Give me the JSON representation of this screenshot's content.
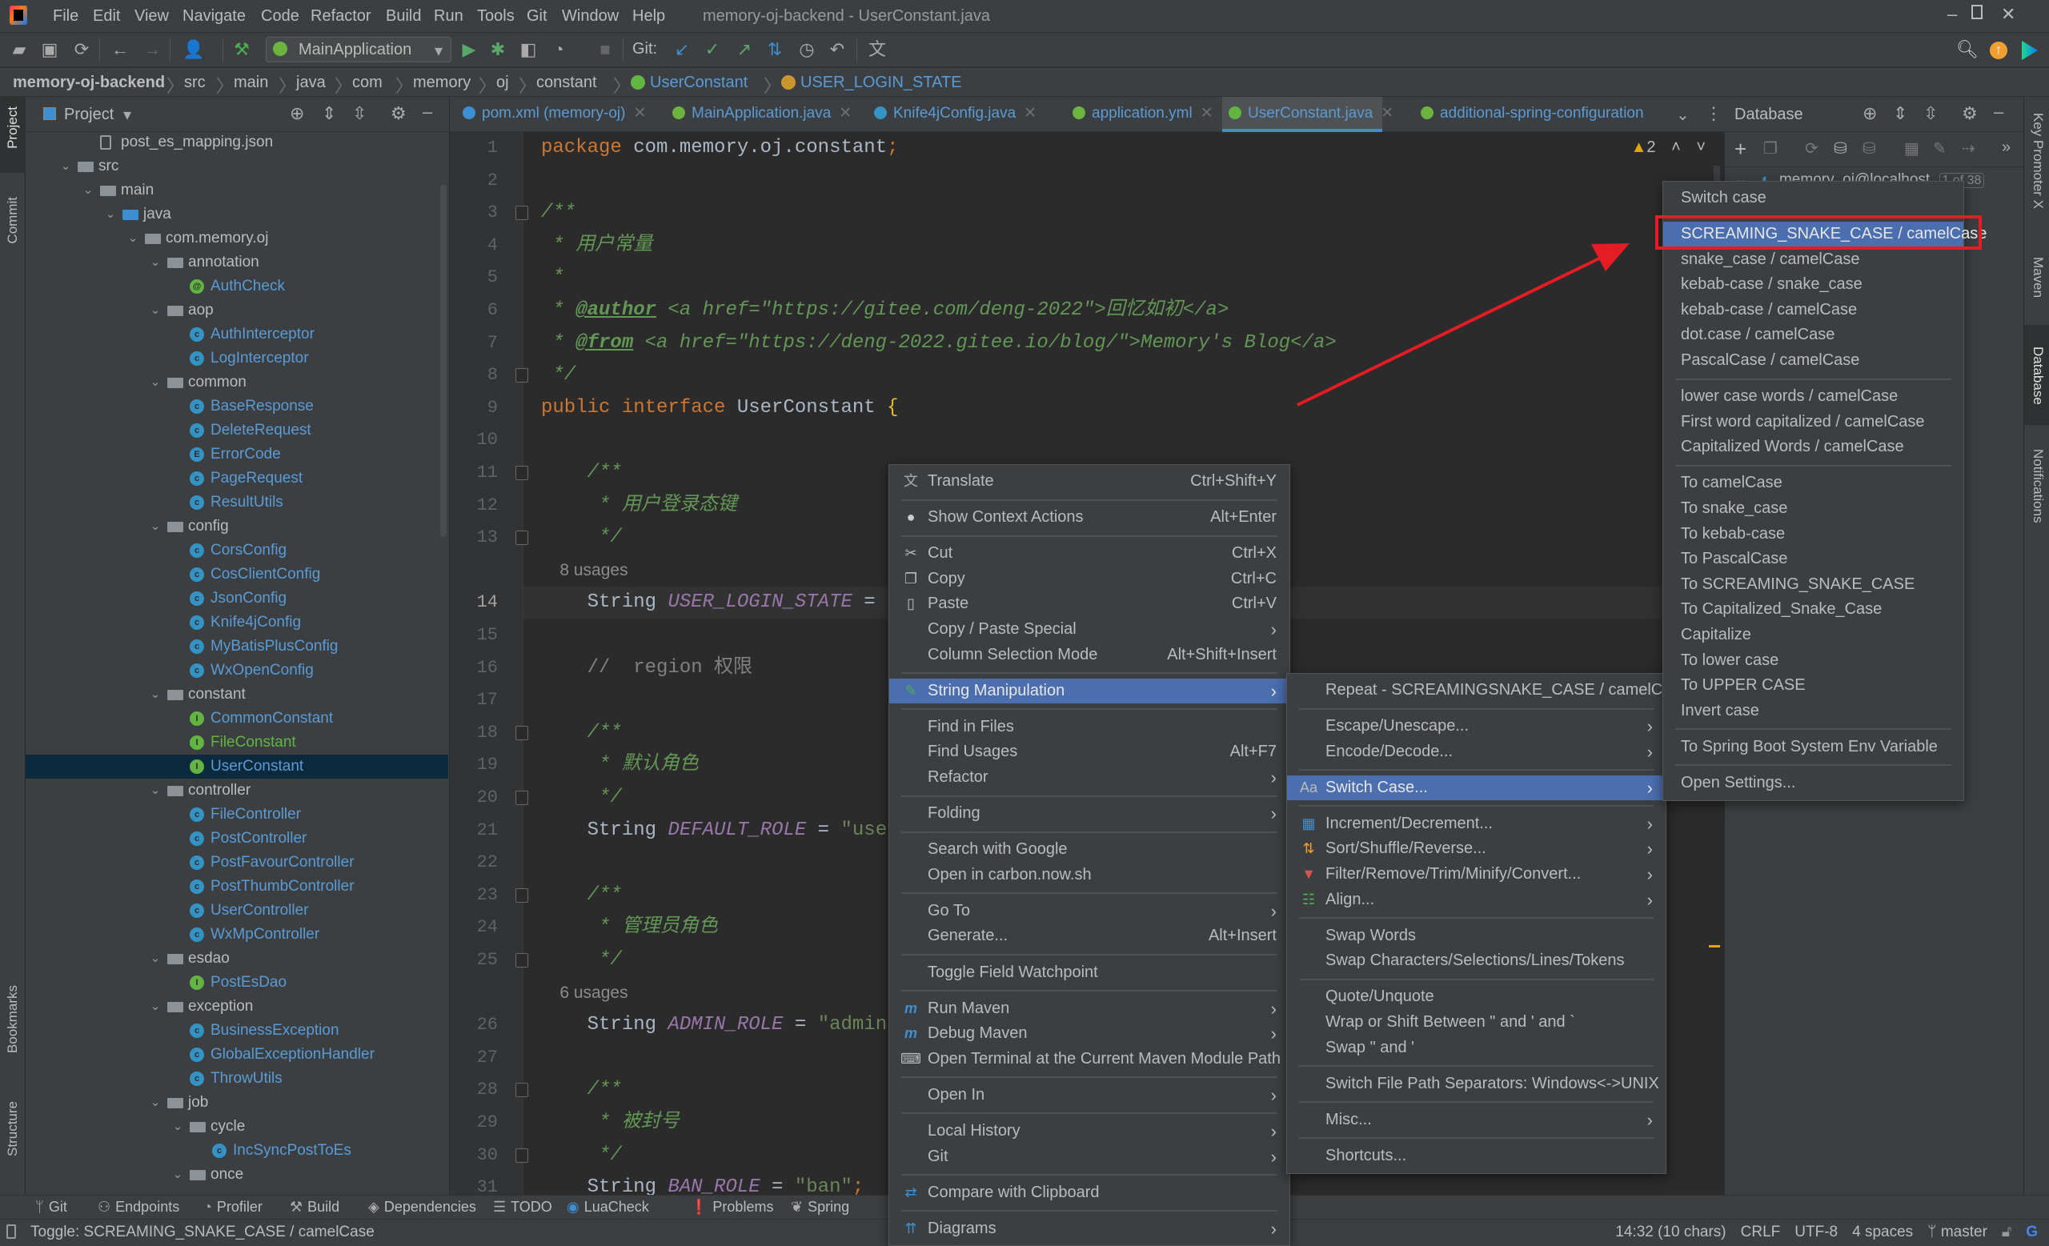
{
  "window": {
    "title": "memory-oj-backend - UserConstant.java",
    "menu": [
      "File",
      "Edit",
      "View",
      "Navigate",
      "Code",
      "Refactor",
      "Build",
      "Run",
      "Tools",
      "Git",
      "Window",
      "Help"
    ]
  },
  "toolbar": {
    "run_config": "MainApplication",
    "git_label": "Git:"
  },
  "breadcrumb": [
    "memory-oj-backend",
    "src",
    "main",
    "java",
    "com",
    "memory",
    "oj",
    "constant",
    "UserConstant",
    "USER_LOGIN_STATE"
  ],
  "left_stripe": {
    "project": "Project",
    "commit": "Commit",
    "bookmarks": "Bookmarks",
    "structure": "Structure"
  },
  "right_stripe": {
    "key_promoter": "Key Promoter X",
    "maven": "Maven",
    "database": "Database",
    "notifications": "Notifications"
  },
  "project": {
    "title": "Project",
    "tree": [
      {
        "label": "post_es_mapping.json",
        "level": 3,
        "type": "file"
      },
      {
        "label": "src",
        "level": 2,
        "type": "folder",
        "expanded": true
      },
      {
        "label": "main",
        "level": 3,
        "type": "folder",
        "expanded": true
      },
      {
        "label": "java",
        "level": 4,
        "type": "source-folder",
        "expanded": true
      },
      {
        "label": "com.memory.oj",
        "level": 5,
        "type": "package",
        "expanded": true
      },
      {
        "label": "annotation",
        "level": 6,
        "type": "package",
        "expanded": true
      },
      {
        "label": "AuthCheck",
        "level": 7,
        "type": "annotation"
      },
      {
        "label": "aop",
        "level": 6,
        "type": "package",
        "expanded": true
      },
      {
        "label": "AuthInterceptor",
        "level": 7,
        "type": "class"
      },
      {
        "label": "LogInterceptor",
        "level": 7,
        "type": "class"
      },
      {
        "label": "common",
        "level": 6,
        "type": "package",
        "expanded": true
      },
      {
        "label": "BaseResponse",
        "level": 7,
        "type": "class"
      },
      {
        "label": "DeleteRequest",
        "level": 7,
        "type": "class"
      },
      {
        "label": "ErrorCode",
        "level": 7,
        "type": "enum"
      },
      {
        "label": "PageRequest",
        "level": 7,
        "type": "class"
      },
      {
        "label": "ResultUtils",
        "level": 7,
        "type": "class"
      },
      {
        "label": "config",
        "level": 6,
        "type": "package",
        "expanded": true
      },
      {
        "label": "CorsConfig",
        "level": 7,
        "type": "class"
      },
      {
        "label": "CosClientConfig",
        "level": 7,
        "type": "class"
      },
      {
        "label": "JsonConfig",
        "level": 7,
        "type": "class"
      },
      {
        "label": "Knife4jConfig",
        "level": 7,
        "type": "class"
      },
      {
        "label": "MyBatisPlusConfig",
        "level": 7,
        "type": "class"
      },
      {
        "label": "WxOpenConfig",
        "level": 7,
        "type": "class"
      },
      {
        "label": "constant",
        "level": 6,
        "type": "package",
        "expanded": true
      },
      {
        "label": "CommonConstant",
        "level": 7,
        "type": "interface"
      },
      {
        "label": "FileConstant",
        "level": 7,
        "type": "interface",
        "status": "added"
      },
      {
        "label": "UserConstant",
        "level": 7,
        "type": "interface",
        "selected": true
      },
      {
        "label": "controller",
        "level": 6,
        "type": "package",
        "expanded": true
      },
      {
        "label": "FileController",
        "level": 7,
        "type": "class"
      },
      {
        "label": "PostController",
        "level": 7,
        "type": "class"
      },
      {
        "label": "PostFavourController",
        "level": 7,
        "type": "class"
      },
      {
        "label": "PostThumbController",
        "level": 7,
        "type": "class"
      },
      {
        "label": "UserController",
        "level": 7,
        "type": "class"
      },
      {
        "label": "WxMpController",
        "level": 7,
        "type": "class"
      },
      {
        "label": "esdao",
        "level": 6,
        "type": "package",
        "expanded": true
      },
      {
        "label": "PostEsDao",
        "level": 7,
        "type": "interface"
      },
      {
        "label": "exception",
        "level": 6,
        "type": "package",
        "expanded": true
      },
      {
        "label": "BusinessException",
        "level": 7,
        "type": "class"
      },
      {
        "label": "GlobalExceptionHandler",
        "level": 7,
        "type": "class"
      },
      {
        "label": "ThrowUtils",
        "level": 7,
        "type": "class"
      },
      {
        "label": "job",
        "level": 6,
        "type": "package",
        "expanded": true
      },
      {
        "label": "cycle",
        "level": 7,
        "type": "package",
        "expanded": true
      },
      {
        "label": "IncSyncPostToEs",
        "level": 8,
        "type": "class"
      },
      {
        "label": "once",
        "level": 7,
        "type": "package",
        "expanded": true
      }
    ]
  },
  "editor": {
    "tabs": [
      {
        "label": "pom.xml (memory-oj)",
        "icon": "maven-icon"
      },
      {
        "label": "MainApplication.java",
        "icon": "spring-boot-icon"
      },
      {
        "label": "Knife4jConfig.java",
        "icon": "class-icon"
      },
      {
        "label": "application.yml",
        "icon": "spring-config-icon"
      },
      {
        "label": "UserConstant.java",
        "icon": "interface-icon",
        "active": true
      },
      {
        "label": "additional-spring-configuration",
        "icon": "spring-config-icon"
      }
    ],
    "warnings": "2",
    "current_line": 14,
    "lines": [
      {
        "n": 1,
        "seg": [
          {
            "t": "package",
            "k": "keyword"
          },
          {
            "t": " com.memory.oj.constant",
            "k": "plain"
          },
          {
            "t": ";",
            "k": "keyword"
          }
        ]
      },
      {
        "n": 2,
        "seg": []
      },
      {
        "n": 3,
        "seg": [
          {
            "t": "/**",
            "k": "doc"
          }
        ],
        "fold": true
      },
      {
        "n": 4,
        "seg": [
          {
            "t": " * 用户常量",
            "k": "doc"
          }
        ]
      },
      {
        "n": 5,
        "seg": [
          {
            "t": " *",
            "k": "doc"
          }
        ]
      },
      {
        "n": 6,
        "seg": [
          {
            "t": " * ",
            "k": "doc"
          },
          {
            "t": "@author",
            "k": "doctag"
          },
          {
            "t": " <a href=\"https://gitee.com/deng-2022\">回忆如初</a>",
            "k": "doc"
          }
        ]
      },
      {
        "n": 7,
        "seg": [
          {
            "t": " * ",
            "k": "doc"
          },
          {
            "t": "@from",
            "k": "doctag"
          },
          {
            "t": " <a href=\"https://deng-2022.gitee.io/blog/\">Memory's Blog</a>",
            "k": "doc"
          }
        ]
      },
      {
        "n": 8,
        "seg": [
          {
            "t": " */",
            "k": "doc"
          }
        ],
        "fold": true
      },
      {
        "n": 9,
        "seg": [
          {
            "t": "public interface ",
            "k": "keyword"
          },
          {
            "t": "UserConstant ",
            "k": "plain"
          },
          {
            "t": "{",
            "k": "brace"
          }
        ]
      },
      {
        "n": 10,
        "seg": []
      },
      {
        "n": 11,
        "seg": [
          {
            "t": "    /**",
            "k": "doc"
          }
        ],
        "fold": true
      },
      {
        "n": 12,
        "seg": [
          {
            "t": "     * 用户登录态键",
            "k": "doc"
          }
        ]
      },
      {
        "n": 13,
        "seg": [
          {
            "t": "     */",
            "k": "doc"
          }
        ],
        "fold": true
      },
      {
        "n": null,
        "seg": [
          {
            "t": "    8 usages",
            "k": "usages"
          }
        ]
      },
      {
        "n": 14,
        "seg": [
          {
            "t": "    String ",
            "k": "plain"
          },
          {
            "t": "USER_LOGIN_STATE",
            "k": "const"
          },
          {
            "t": " = \"",
            "k": "plain"
          }
        ]
      },
      {
        "n": 15,
        "seg": []
      },
      {
        "n": 16,
        "seg": [
          {
            "t": "    //  region 权限",
            "k": "comment"
          }
        ]
      },
      {
        "n": 17,
        "seg": []
      },
      {
        "n": 18,
        "seg": [
          {
            "t": "    /**",
            "k": "doc"
          }
        ],
        "fold": true
      },
      {
        "n": 19,
        "seg": [
          {
            "t": "     * 默认角色",
            "k": "doc"
          }
        ]
      },
      {
        "n": 20,
        "seg": [
          {
            "t": "     */",
            "k": "doc"
          }
        ],
        "fold": true
      },
      {
        "n": 21,
        "seg": [
          {
            "t": "    String ",
            "k": "plain"
          },
          {
            "t": "DEFAULT_ROLE",
            "k": "const"
          },
          {
            "t": " = ",
            "k": "plain"
          },
          {
            "t": "\"user",
            "k": "string"
          }
        ]
      },
      {
        "n": 22,
        "seg": []
      },
      {
        "n": 23,
        "seg": [
          {
            "t": "    /**",
            "k": "doc"
          }
        ],
        "fold": true
      },
      {
        "n": 24,
        "seg": [
          {
            "t": "     * 管理员角色",
            "k": "doc"
          }
        ]
      },
      {
        "n": 25,
        "seg": [
          {
            "t": "     */",
            "k": "doc"
          }
        ],
        "fold": true
      },
      {
        "n": null,
        "seg": [
          {
            "t": "    6 usages",
            "k": "usages"
          }
        ]
      },
      {
        "n": 26,
        "seg": [
          {
            "t": "    String ",
            "k": "plain"
          },
          {
            "t": "ADMIN_ROLE",
            "k": "const"
          },
          {
            "t": " = ",
            "k": "plain"
          },
          {
            "t": "\"admin\"",
            "k": "string"
          }
        ]
      },
      {
        "n": 27,
        "seg": []
      },
      {
        "n": 28,
        "seg": [
          {
            "t": "    /**",
            "k": "doc"
          }
        ],
        "fold": true
      },
      {
        "n": 29,
        "seg": [
          {
            "t": "     * 被封号",
            "k": "doc"
          }
        ]
      },
      {
        "n": 30,
        "seg": [
          {
            "t": "     */",
            "k": "doc"
          }
        ],
        "fold": true
      },
      {
        "n": 31,
        "seg": [
          {
            "t": "    String ",
            "k": "plain"
          },
          {
            "t": "BAN_ROLE",
            "k": "const"
          },
          {
            "t": " = ",
            "k": "plain"
          },
          {
            "t": "\"ban\"",
            "k": "string"
          },
          {
            "t": ";",
            "k": "keyword"
          }
        ]
      }
    ]
  },
  "database": {
    "title": "Database",
    "datasource": "memory_oj@localhost",
    "count": "1 of 38"
  },
  "context_menu": [
    {
      "label": "Translate",
      "shortcut": "Ctrl+Shift+Y",
      "icon": "translate-icon"
    },
    {
      "sep": true
    },
    {
      "label": "Show Context Actions",
      "shortcut": "Alt+Enter",
      "icon": "lightbulb-icon"
    },
    {
      "sep": true
    },
    {
      "label": "Cut",
      "shortcut": "Ctrl+X",
      "icon": "scissors-icon"
    },
    {
      "label": "Copy",
      "shortcut": "Ctrl+C",
      "icon": "copy-icon"
    },
    {
      "label": "Paste",
      "shortcut": "Ctrl+V",
      "icon": "paste-icon"
    },
    {
      "label": "Copy / Paste Special",
      "submenu": true
    },
    {
      "label": "Column Selection Mode",
      "shortcut": "Alt+Shift+Insert"
    },
    {
      "sep": true
    },
    {
      "label": "String Manipulation",
      "submenu": true,
      "icon": "pencil-icon",
      "highlighted": true
    },
    {
      "sep": true
    },
    {
      "label": "Find in Files"
    },
    {
      "label": "Find Usages",
      "shortcut": "Alt+F7"
    },
    {
      "label": "Refactor",
      "submenu": true
    },
    {
      "sep": true
    },
    {
      "label": "Folding",
      "submenu": true
    },
    {
      "sep": true
    },
    {
      "label": "Search with Google"
    },
    {
      "label": "Open in carbon.now.sh"
    },
    {
      "sep": true
    },
    {
      "label": "Go To",
      "submenu": true
    },
    {
      "label": "Generate...",
      "shortcut": "Alt+Insert"
    },
    {
      "sep": true
    },
    {
      "label": "Toggle Field Watchpoint"
    },
    {
      "sep": true
    },
    {
      "label": "Run Maven",
      "submenu": true,
      "icon": "maven-run-icon"
    },
    {
      "label": "Debug Maven",
      "submenu": true,
      "icon": "maven-debug-icon"
    },
    {
      "label": "Open Terminal at the Current Maven Module Path",
      "icon": "terminal-maven-icon"
    },
    {
      "sep": true
    },
    {
      "label": "Open In",
      "submenu": true
    },
    {
      "sep": true
    },
    {
      "label": "Local History",
      "submenu": true
    },
    {
      "label": "Git",
      "submenu": true
    },
    {
      "sep": true
    },
    {
      "label": "Compare with Clipboard",
      "icon": "compare-icon"
    },
    {
      "sep": true
    },
    {
      "label": "Diagrams",
      "submenu": true,
      "icon": "diagram-icon"
    }
  ],
  "string_manipulation_menu": [
    {
      "label": "Repeat - SCREAMINGSNAKE_CASE / camelCase"
    },
    {
      "sep": true
    },
    {
      "label": "Escape/Unescape...",
      "submenu": true
    },
    {
      "label": "Encode/Decode...",
      "submenu": true
    },
    {
      "sep": true
    },
    {
      "label": "Switch Case...",
      "submenu": true,
      "icon": "switch-case-icon",
      "highlighted": true
    },
    {
      "sep": true
    },
    {
      "label": "Increment/Decrement...",
      "submenu": true,
      "icon": "calculator-icon"
    },
    {
      "label": "Sort/Shuffle/Reverse...",
      "submenu": true,
      "icon": "sort-icon"
    },
    {
      "label": "Filter/Remove/Trim/Minify/Convert...",
      "submenu": true,
      "icon": "filter-icon"
    },
    {
      "label": "Align...",
      "submenu": true,
      "icon": "align-icon"
    },
    {
      "sep": true
    },
    {
      "label": "Swap Words"
    },
    {
      "label": "Swap Characters/Selections/Lines/Tokens"
    },
    {
      "sep": true
    },
    {
      "label": "Quote/Unquote"
    },
    {
      "label": "Wrap or Shift Between \" and ' and `"
    },
    {
      "label": "Swap \" and '"
    },
    {
      "sep": true
    },
    {
      "label": "Switch File Path Separators: Windows<->UNIX"
    },
    {
      "sep": true
    },
    {
      "label": "Misc...",
      "submenu": true
    },
    {
      "sep": true
    },
    {
      "label": "Shortcuts..."
    }
  ],
  "switch_case_menu": [
    {
      "label": "Switch case"
    },
    {
      "sep": true
    },
    {
      "label": "SCREAMING_SNAKE_CASE / camelCase",
      "highlighted": true,
      "annotated": true
    },
    {
      "label": "snake_case / camelCase"
    },
    {
      "label": "kebab-case / snake_case"
    },
    {
      "label": "kebab-case / camelCase"
    },
    {
      "label": "dot.case / camelCase"
    },
    {
      "label": "PascalCase / camelCase"
    },
    {
      "sep": true
    },
    {
      "label": "lower case words / camelCase"
    },
    {
      "label": "First word capitalized / camelCase"
    },
    {
      "label": "Capitalized Words / camelCase"
    },
    {
      "sep": true
    },
    {
      "label": "To camelCase"
    },
    {
      "label": "To snake_case"
    },
    {
      "label": "To kebab-case"
    },
    {
      "label": "To PascalCase"
    },
    {
      "label": "To SCREAMING_SNAKE_CASE"
    },
    {
      "label": "To Capitalized_Snake_Case"
    },
    {
      "label": "Capitalize"
    },
    {
      "label": "To lower case"
    },
    {
      "label": "To UPPER CASE"
    },
    {
      "label": "Invert case"
    },
    {
      "sep": true
    },
    {
      "label": "To Spring Boot System Env Variable"
    },
    {
      "sep": true
    },
    {
      "label": "Open Settings..."
    }
  ],
  "bottom_tools": [
    "Git",
    "Endpoints",
    "Profiler",
    "Build",
    "Dependencies",
    "TODO",
    "LuaCheck",
    "Problems",
    "Spring"
  ],
  "status": {
    "message": "Toggle: SCREAMING_SNAKE_CASE / camelCase",
    "position": "14:32 (10 chars)",
    "line_sep": "CRLF",
    "encoding": "UTF-8",
    "indent": "4 spaces",
    "branch": "master"
  },
  "colors": {
    "accent": "#4b6eaf",
    "annotation": "#e51c23",
    "selection": "#0d293e"
  }
}
